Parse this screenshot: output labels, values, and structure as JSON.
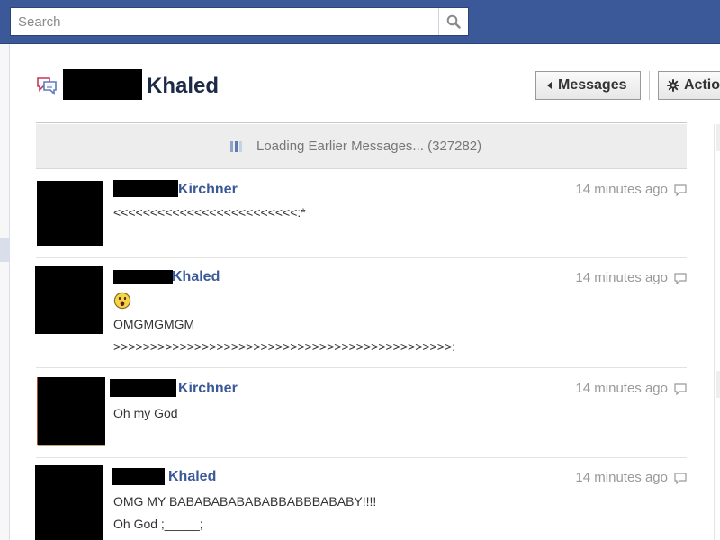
{
  "search": {
    "placeholder": "Search",
    "value": ""
  },
  "conversation": {
    "title_name": "Khaled"
  },
  "header_buttons": {
    "messages_label": "Messages",
    "actions_label": "Actio"
  },
  "loading": {
    "text": "Loading Earlier Messages... (327282)"
  },
  "messages": [
    {
      "author": "Kirchner",
      "time": "14 minutes ago",
      "lines": [
        "<<<<<<<<<<<<<<<<<<<<<<<<<:*"
      ]
    },
    {
      "author": "Khaled",
      "time": "14 minutes ago",
      "emoji": "shocked-face",
      "lines": [
        "OMGMGMGM",
        ">>>>>>>>>>>>>>>>>>>>>>>>>>>>>>>>>>>>>>>>>>>>>>:"
      ]
    },
    {
      "author": "Kirchner",
      "time": "14 minutes ago",
      "lines": [
        "Oh my God"
      ]
    },
    {
      "author": "Khaled",
      "time": "14 minutes ago",
      "lines": [
        "OMG MY BABABABABABABBABBBABABY!!!!",
        "Oh God ;_____;"
      ]
    }
  ],
  "colors": {
    "topbar": "#3b5998",
    "author_link": "#3b5998",
    "title": "#1c2a47",
    "timestamp": "#999999"
  },
  "icons": {
    "search": "magnifier-icon",
    "conversation": "chat-bubbles-icon",
    "messages_button": "caret-left-icon",
    "actions_button": "gear-icon",
    "loading": "loading-bars-icon",
    "reply": "speech-bubble-icon"
  }
}
